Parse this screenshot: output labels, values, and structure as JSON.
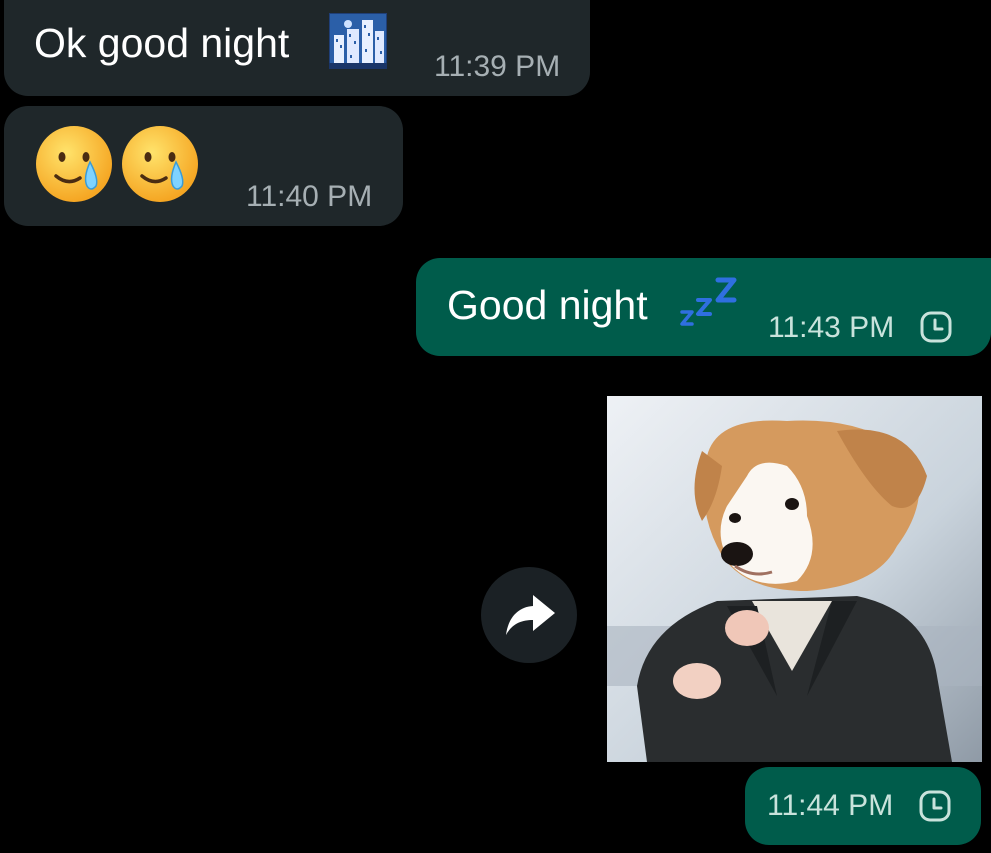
{
  "messages": [
    {
      "direction": "incoming",
      "text": "Ok good night",
      "emoji": "night-city-emoji",
      "time": "11:39 PM"
    },
    {
      "direction": "incoming",
      "emoji": [
        "smiling-face-with-tear-emoji",
        "smiling-face-with-tear-emoji"
      ],
      "time": "11:40 PM"
    },
    {
      "direction": "outgoing",
      "text": "Good night",
      "emoji": "zzz-emoji",
      "time": "11:43 PM",
      "status_icon": "clock-icon"
    },
    {
      "direction": "outgoing",
      "sticker": "puppy-in-suit-sticker",
      "time": "11:44 PM",
      "status_icon": "clock-icon"
    }
  ],
  "actions": {
    "forward_icon": "forward-arrow-icon"
  },
  "colors": {
    "background": "#000000",
    "incoming_bubble": "#1f272a",
    "outgoing_bubble": "#005c4b",
    "incoming_time": "#a6afb3",
    "outgoing_time": "#c9e3dc",
    "forward_button": "#1b2125"
  }
}
